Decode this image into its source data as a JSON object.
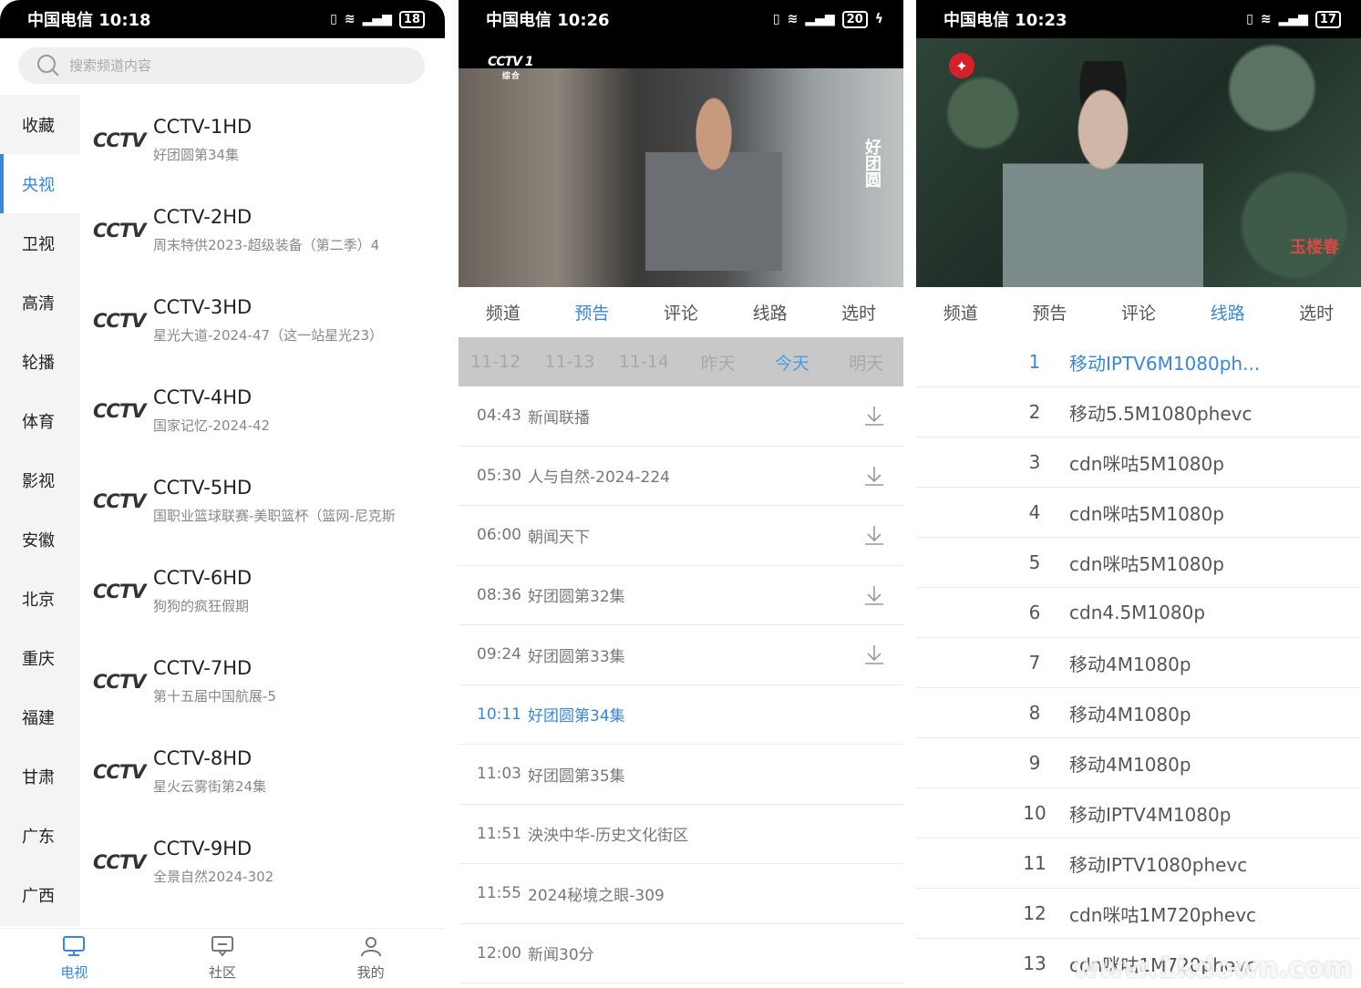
{
  "panel1": {
    "status": {
      "carrier_time": "中国电信 10:18",
      "battery": "18"
    },
    "search": {
      "placeholder": "搜索频道内容"
    },
    "categories": [
      "收藏",
      "央视",
      "卫视",
      "高清",
      "轮播",
      "体育",
      "影视",
      "安徽",
      "北京",
      "重庆",
      "福建",
      "甘肃",
      "广东",
      "广西"
    ],
    "active_category": "央视",
    "channels": [
      {
        "logo": "CCTV",
        "name": "CCTV-1HD",
        "program": "好团圆第34集"
      },
      {
        "logo": "CCTV",
        "name": "CCTV-2HD",
        "program": "周末特供2023-超级装备（第二季）4"
      },
      {
        "logo": "CCTV",
        "name": "CCTV-3HD",
        "program": "星光大道-2024-47（这一站星光23）"
      },
      {
        "logo": "CCTV",
        "name": "CCTV-4HD",
        "program": "国家记忆-2024-42"
      },
      {
        "logo": "CCTV",
        "name": "CCTV-5HD",
        "program": "国职业篮球联赛-美职篮杯（篮网-尼克斯"
      },
      {
        "logo": "CCTV",
        "name": "CCTV-6HD",
        "program": "狗狗的疯狂假期"
      },
      {
        "logo": "CCTV",
        "name": "CCTV-7HD",
        "program": "第十五届中国航展-5"
      },
      {
        "logo": "CCTV",
        "name": "CCTV-8HD",
        "program": "星火云雾街第24集"
      },
      {
        "logo": "CCTV",
        "name": "CCTV-9HD",
        "program": "全景自然2024-302"
      }
    ],
    "nav": [
      {
        "label": "电视",
        "icon": "tv-icon",
        "active": true
      },
      {
        "label": "社区",
        "icon": "chat-icon",
        "active": false
      },
      {
        "label": "我的",
        "icon": "user-icon",
        "active": false
      }
    ]
  },
  "panel2": {
    "status": {
      "carrier_time": "中国电信 10:26",
      "battery": "20"
    },
    "video": {
      "channel_mark": "CCTV 1",
      "channel_sub": "综 合",
      "show_mark": "好团圆"
    },
    "tabs": [
      "频道",
      "预告",
      "评论",
      "线路",
      "选时"
    ],
    "active_tab": "预告",
    "dates": [
      "11-12",
      "11-13",
      "11-14",
      "昨天",
      "今天",
      "明天"
    ],
    "active_date": "今天",
    "epg": [
      {
        "time": "04:43",
        "title": "新闻联播",
        "download": true
      },
      {
        "time": "05:30",
        "title": "人与自然-2024-224",
        "download": true
      },
      {
        "time": "06:00",
        "title": "朝闻天下",
        "download": true
      },
      {
        "time": "08:36",
        "title": "好团圆第32集",
        "download": true
      },
      {
        "time": "09:24",
        "title": "好团圆第33集",
        "download": true
      },
      {
        "time": "10:11",
        "title": "好团圆第34集",
        "download": false,
        "current": true
      },
      {
        "time": "11:03",
        "title": "好团圆第35集",
        "download": false
      },
      {
        "time": "11:51",
        "title": "泱泱中华-历史文化街区",
        "download": false
      },
      {
        "time": "11:55",
        "title": "2024秘境之眼-309",
        "download": false
      },
      {
        "time": "12:00",
        "title": "新闻30分",
        "download": false
      }
    ]
  },
  "panel3": {
    "status": {
      "carrier_time": "中国电信 10:23",
      "battery": "17"
    },
    "video": {
      "show_mark": "玉楼春"
    },
    "tabs": [
      "频道",
      "预告",
      "评论",
      "线路",
      "选时"
    ],
    "active_tab": "线路",
    "lines": [
      {
        "num": "1",
        "name": "移动IPTV6M1080ph...",
        "active": true
      },
      {
        "num": "2",
        "name": "移动5.5M1080phevc"
      },
      {
        "num": "3",
        "name": "cdn咪咕5M1080p"
      },
      {
        "num": "4",
        "name": "cdn咪咕5M1080p"
      },
      {
        "num": "5",
        "name": "cdn咪咕5M1080p"
      },
      {
        "num": "6",
        "name": "cdn4.5M1080p"
      },
      {
        "num": "7",
        "name": "移动4M1080p"
      },
      {
        "num": "8",
        "name": "移动4M1080p"
      },
      {
        "num": "9",
        "name": "移动4M1080p"
      },
      {
        "num": "10",
        "name": "移动IPTV4M1080p"
      },
      {
        "num": "11",
        "name": "移动IPTV1080phevc"
      },
      {
        "num": "12",
        "name": "cdn咪咕1M720phevc"
      },
      {
        "num": "13",
        "name": "cdn咪咕1M720phevc"
      }
    ]
  },
  "watermark": "www.1kdown.com"
}
